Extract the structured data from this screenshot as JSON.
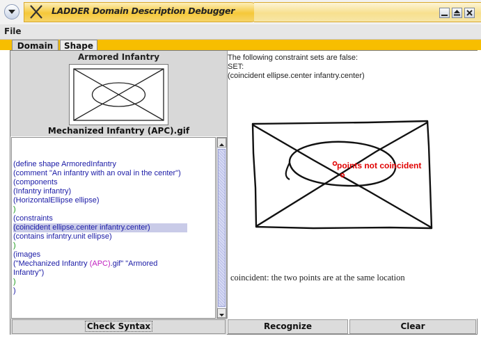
{
  "window": {
    "title": "LADDER Domain Description Debugger"
  },
  "menu": {
    "file": "File"
  },
  "tabs": [
    {
      "label": "Domain",
      "active": false
    },
    {
      "label": "Shape",
      "active": true
    }
  ],
  "shape_panel": {
    "shape_name": "Armored Infantry",
    "image_file": "Mechanized Infantry (APC).gif"
  },
  "code": {
    "lines": [
      {
        "text": "(define shape ArmoredInfantry",
        "color": "#1a1aa6"
      },
      {
        "text": "  (comment \"An infantry with an oval in the center\")",
        "color": "#1a1aa6"
      },
      {
        "text": "  (components",
        "color": "#1a1aa6"
      },
      {
        "text": "    (Infantry infantry)",
        "color": "#1a1aa6"
      },
      {
        "text": "    (HorizontalEllipse ellipse)",
        "color": "#1a1aa6"
      },
      {
        "text": "  )",
        "color": "#1a9a1a"
      },
      {
        "text": "  (constraints",
        "color": "#1a1aa6"
      },
      {
        "text": "    (coincident ellipse.center infantry.center)",
        "color": "#1a1aa6",
        "highlight": true
      },
      {
        "text": "    (contains infantry.unit ellipse)",
        "color": "#1a1aa6"
      },
      {
        "text": "  )",
        "color": "#1a9a1a"
      },
      {
        "text": "  (images",
        "color": "#1a1aa6"
      },
      {
        "text": "    (\"Mechanized Infantry (APC).gif\" \"Armored",
        "color": "#1a1aa6"
      },
      {
        "text": "Infantry\")",
        "color": "#1a1aa6"
      },
      {
        "text": "  )",
        "color": "#1a9a1a"
      },
      {
        "text": ")",
        "color": "#1a1aa6"
      }
    ]
  },
  "buttons": {
    "check_syntax": "Check Syntax",
    "recognize": "Recognize",
    "clear": "Clear"
  },
  "constraint_report": {
    "header": "The following constraint sets are false:",
    "set_label": "SET:",
    "constraint": "(coincident ellipse.center infantry.center)",
    "annotation": "points not coincident",
    "annotation_color": "#e00000",
    "description": "coincident: the two points are at the same location"
  },
  "colors": {
    "accent_tabstrip": "#f7be00",
    "title_bar": "#f5c83a",
    "highlight": "#c9cbe8"
  }
}
